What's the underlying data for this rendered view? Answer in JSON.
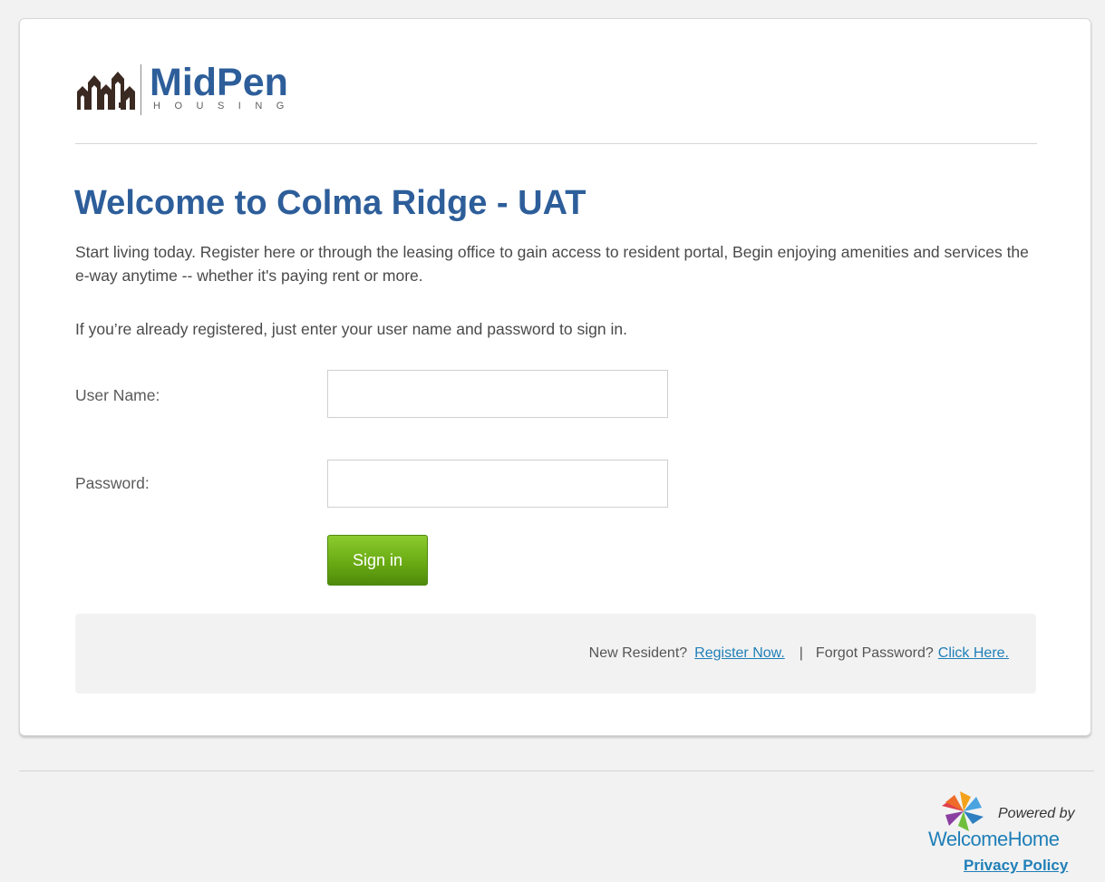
{
  "logo": {
    "name": "MidPen",
    "subtitle": "HOUSING",
    "brand_color": "#2d5e9a"
  },
  "page": {
    "title": "Welcome to Colma Ridge - UAT",
    "intro": "Start living today. Register here or through the leasing office to gain access to resident portal, Begin enjoying amenities and services the e-way anytime -- whether it's paying rent or more.",
    "already_registered": "If you’re already registered, just enter your user name and password to sign in."
  },
  "form": {
    "username_label": "User Name:",
    "username_value": "",
    "password_label": "Password:",
    "password_value": "",
    "signin_label": "Sign in",
    "signin_color": "#6aab14"
  },
  "links": {
    "new_resident_text": "New Resident?",
    "register_link": "Register Now.",
    "separator": "|",
    "forgot_text": "Forgot Password?",
    "click_here_link": "Click Here.",
    "link_color": "#1f7fb8"
  },
  "footer": {
    "powered_by": "Powered by",
    "brand": "WelcomeHome",
    "privacy": "Privacy Policy",
    "pinwheel_icon": "pinwheel-icon"
  }
}
